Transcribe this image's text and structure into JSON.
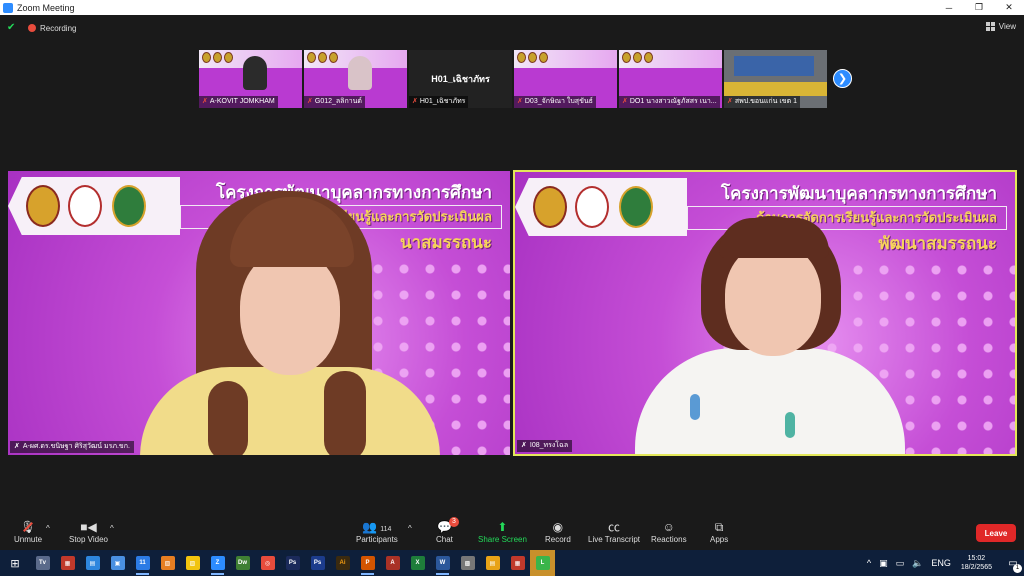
{
  "window": {
    "title": "Zoom Meeting",
    "minimize": "─",
    "restore": "❐",
    "close": "✕"
  },
  "infobar": {
    "recording_label": "Recording",
    "view_label": "View",
    "shield": "✔"
  },
  "thumbnails": [
    {
      "label": "A-KOVIT JOMKHAM",
      "mute": "✗"
    },
    {
      "label": "G012_ลลิกานต์",
      "mute": "✗"
    },
    {
      "label": "H01_เฉิชาภัทร",
      "center_name": "H01_เฉิชาภัทร",
      "mute": "✗"
    },
    {
      "label": "D03_จักษิณา ใบสุขันธ์",
      "mute": "✗"
    },
    {
      "label": "DO1 นางสาวณัฐภัสสร เนา...",
      "mute": "✗"
    },
    {
      "label": "สพป.ขอนแก่น เขต 1",
      "mute": "✗"
    }
  ],
  "next_icon": "❯",
  "banner": {
    "line1": "โครงการพัฒนาบุคลากรทางการศึกษา",
    "line2": "ด้านการจัดการเรียนรู้และการวัดประเมินผล",
    "line3_left": "นาสมรรถนะ",
    "line3_right": "พัฒนาสมรรถนะ"
  },
  "panels": {
    "left_label": "A-ผศ.ดร.ขนิษฐา ศิริสุวัฒน์ มรภ.ขก.",
    "right_label": "I08_ทรงโฉล",
    "mute": "✗"
  },
  "toolbar": {
    "unmute": "Unmute",
    "stop_video": "Stop Video",
    "participants": "Participants",
    "participants_count": "114",
    "chat": "Chat",
    "chat_badge": "3",
    "share_screen": "Share Screen",
    "record": "Record",
    "live_transcript": "Live Transcript",
    "reactions": "Reactions",
    "apps": "Apps",
    "leave": "Leave",
    "caret": "^"
  },
  "taskbar": {
    "start": "⊞",
    "apps": [
      "Tv",
      "▦",
      "▤",
      "▣",
      "11",
      "▧",
      "▨",
      "Z",
      "Dw",
      "◎",
      "Ps",
      "Ps",
      "Ai",
      "P",
      "A",
      "X",
      "W",
      "▩",
      "▤",
      "▦",
      "L"
    ],
    "tray_lang": "ENG",
    "time": "15:02",
    "date": "18/2/2565",
    "notif": "▭",
    "notif_count": "1",
    "tray_up": "^"
  },
  "colors": {
    "accent": "#2d8cff",
    "share_green": "#23d959",
    "leave_red": "#e02828",
    "active_border": "#e3e85a"
  }
}
